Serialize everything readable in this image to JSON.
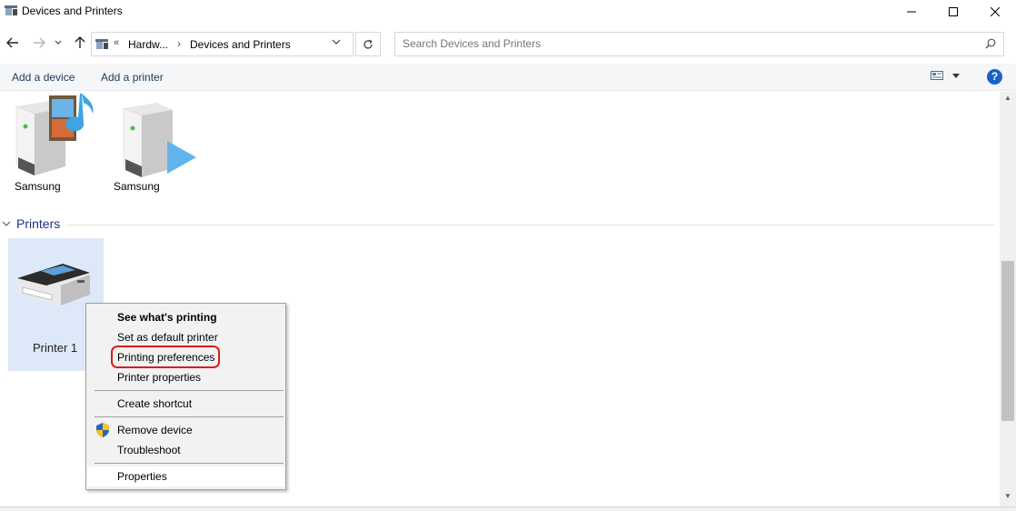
{
  "window": {
    "title": "Devices and Printers"
  },
  "address": {
    "chevron": "«",
    "segment1": "Hardw...",
    "separator": "›",
    "segment2": "Devices and Printers"
  },
  "search": {
    "placeholder": "Search Devices and Printers"
  },
  "commands": {
    "add_device": "Add a device",
    "add_printer": "Add a printer",
    "help": "?"
  },
  "devices": [
    {
      "label": "Samsung",
      "icon": "media-server-icon"
    },
    {
      "label": "Samsung",
      "icon": "media-player-icon"
    }
  ],
  "printers_group": {
    "title": "Printers",
    "items": [
      {
        "label": "Printer 1",
        "icon": "printer-icon"
      }
    ]
  },
  "context_menu": {
    "items": [
      {
        "label": "See what's printing",
        "bold": true
      },
      {
        "label": "Set as default printer"
      },
      {
        "label": "Printing preferences",
        "outlined": true
      },
      {
        "label": "Printer properties"
      },
      {
        "label": "Create shortcut"
      },
      {
        "label": "Remove device",
        "icon": "uac-shield-icon"
      },
      {
        "label": "Troubleshoot"
      },
      {
        "label": "Properties",
        "highlighted": true
      }
    ]
  },
  "colors": {
    "accent": "#1e3287",
    "selection": "#dde9f8",
    "outline": "#e01b1b",
    "help": "#1a63c6"
  }
}
